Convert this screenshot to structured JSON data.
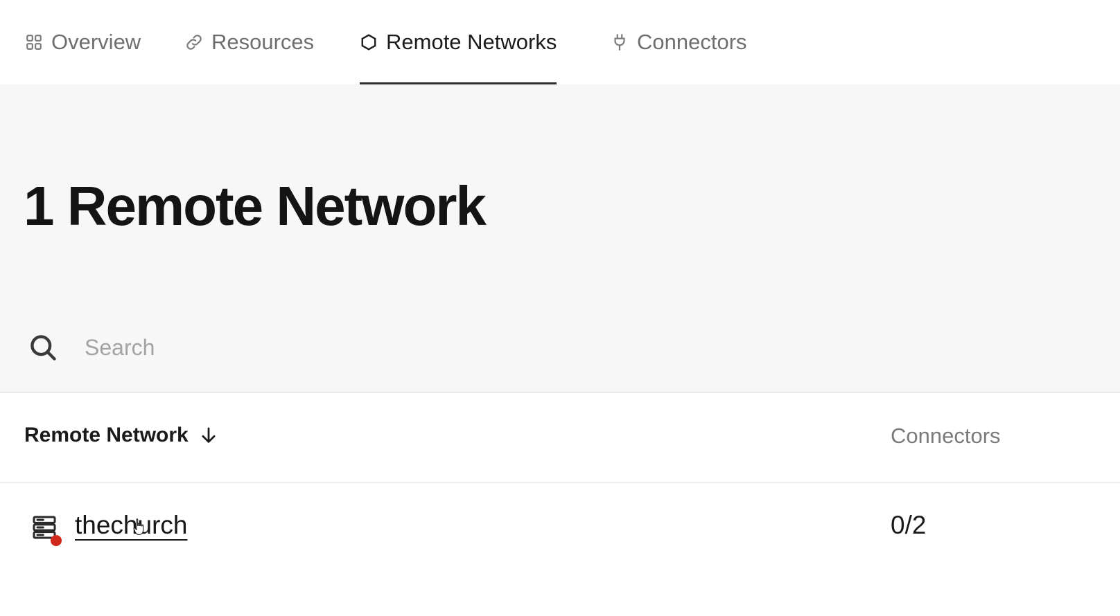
{
  "tabs": [
    {
      "label": "Overview",
      "icon": "grid-icon",
      "active": false
    },
    {
      "label": "Resources",
      "icon": "link-icon",
      "active": false
    },
    {
      "label": "Remote Networks",
      "icon": "hexagon-icon",
      "active": true
    },
    {
      "label": "Connectors",
      "icon": "plug-icon",
      "active": false
    }
  ],
  "header": {
    "title": "1 Remote Network"
  },
  "search": {
    "placeholder": "Search",
    "value": ""
  },
  "table": {
    "columns": {
      "network": "Remote Network",
      "network_sort": "descending",
      "connectors": "Connectors"
    },
    "rows": [
      {
        "name": "thechurch",
        "connectors": "0/2",
        "status": "offline",
        "status_color": "#d0281a"
      }
    ]
  },
  "colors": {
    "background": "#ffffff",
    "header_background": "#f7f7f7",
    "active_tab_text": "#1b1b1b",
    "inactive_tab_text": "#6e6e6e",
    "status_offline": "#d0281a"
  }
}
